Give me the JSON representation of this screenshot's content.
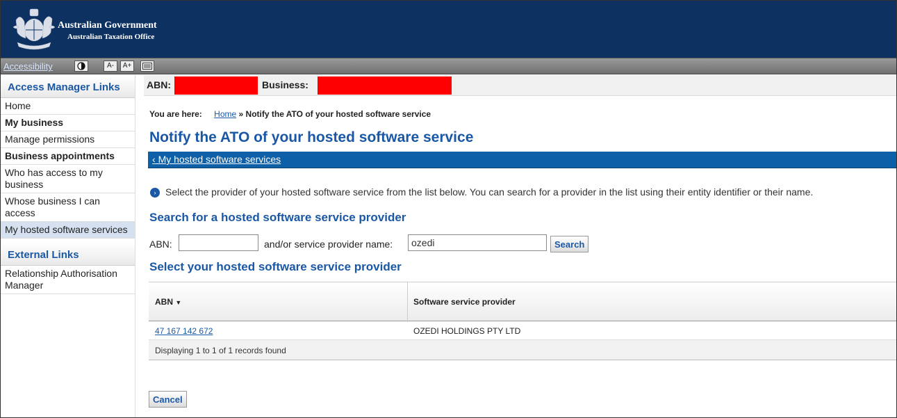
{
  "header": {
    "gov_line1": "Australian Government",
    "gov_line2": "Australian Taxation Office",
    "colors": {
      "header_bg": "#0d3160",
      "link_blue": "#1a58a6",
      "back_bar": "#0d5fa8",
      "redaction": "#ff0000"
    }
  },
  "access_bar": {
    "link": "Accessibility",
    "contrast_icon": "contrast-icon",
    "text_smaller": "A-",
    "text_larger": "A+",
    "layout_icon": "layout-icon"
  },
  "sidebar": {
    "heading1": "Access Manager Links",
    "items1": [
      {
        "label": "Home",
        "bold": false,
        "active": false
      },
      {
        "label": "My business",
        "bold": true,
        "active": false
      },
      {
        "label": "Manage permissions",
        "bold": false,
        "active": false
      },
      {
        "label": "Business appointments",
        "bold": true,
        "active": false
      },
      {
        "label": "Who has access to my business",
        "bold": false,
        "active": false
      },
      {
        "label": "Whose business I can access",
        "bold": false,
        "active": false
      },
      {
        "label": "My hosted software services",
        "bold": false,
        "active": true
      }
    ],
    "heading2": "External Links",
    "items2": [
      {
        "label": "Relationship Authorisation Manager"
      }
    ]
  },
  "main": {
    "abn_label": "ABN:",
    "business_label": "Business:",
    "breadcrumb": {
      "prefix": "You are here:",
      "home": "Home",
      "separator": "»",
      "current": "Notify the ATO of your hosted software service"
    },
    "title": "Notify the ATO of your hosted software service",
    "back_link": "My hosted software services",
    "info_text": "Select the provider of your hosted software service from the list below. You can search for a provider in the list using their entity identifier or their name.",
    "search_heading": "Search for a hosted software service provider",
    "abn_field_label": "ABN:",
    "abn_field_value": "",
    "name_field_label": "and/or service provider name:",
    "name_field_value": "ozedi",
    "search_button": "Search",
    "select_heading": "Select your hosted software service provider",
    "table": {
      "columns": [
        "ABN",
        "Software service provider"
      ],
      "sort_indicator": "▼",
      "rows": [
        {
          "abn": "47 167 142 672",
          "provider": "OZEDI HOLDINGS PTY LTD"
        }
      ],
      "footer": "Displaying 1 to 1 of 1 records found"
    },
    "cancel_button": "Cancel"
  }
}
